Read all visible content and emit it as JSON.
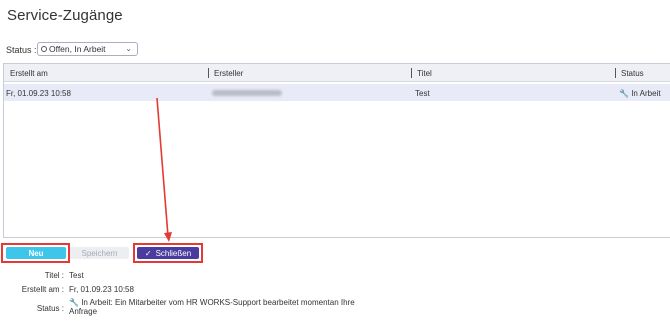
{
  "page_title": "Service-Zugänge",
  "status_filter": {
    "label": "Status :",
    "value": "Offen, In Arbeit"
  },
  "table": {
    "columns": [
      "Erstellt am",
      "Ersteller",
      "Titel",
      "Status"
    ],
    "rows": [
      {
        "erstellt_am": "Fr, 01.09.23 10:58",
        "ersteller": "",
        "titel": "Test",
        "status": "In Arbeit"
      }
    ]
  },
  "buttons": {
    "new": "Neu",
    "save": "Speichern",
    "close": "Schließen"
  },
  "details": {
    "title_label": "Titel :",
    "title_value": "Test",
    "created_label": "Erstellt am :",
    "created_value": "Fr, 01.09.23 10:58",
    "status_label": "Status :",
    "status_value_line1": "In Arbeit: Ein Mitarbeiter vom HR WORKS-Support bearbeitet momentan Ihre",
    "status_value_line2": "Anfrage"
  },
  "colors": {
    "accent_new": "#3ec6ea",
    "accent_close": "#4a3c9e",
    "highlight": "#e53935"
  },
  "icons": [
    "clock-icon",
    "wrench-icon",
    "chevron-down-icon",
    "check-icon"
  ]
}
